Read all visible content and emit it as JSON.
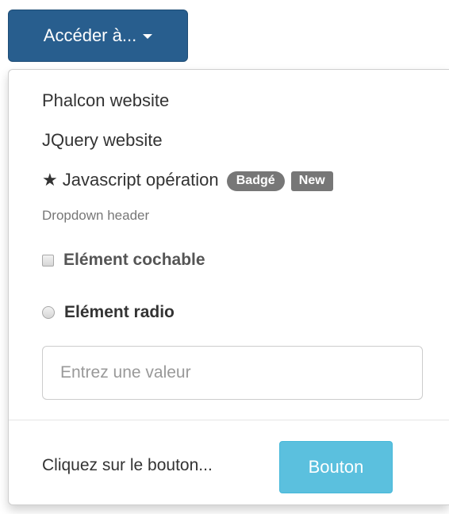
{
  "toggle": {
    "label": "Accéder à...",
    "color": "#285e8e"
  },
  "menu": {
    "items": [
      {
        "label": "Phalcon website"
      },
      {
        "label": "JQuery website"
      },
      {
        "label": "Javascript opération",
        "icon": "star-icon",
        "badge": "Badgé",
        "label_tag": "New"
      }
    ],
    "header": "Dropdown header",
    "checkbox": {
      "label": "Elément cochable",
      "checked": false
    },
    "radio": {
      "label": "Elément radio",
      "checked": false
    },
    "input": {
      "placeholder": "Entrez une valeur",
      "value": ""
    },
    "footer": {
      "text": "Cliquez sur le bouton...",
      "button_label": "Bouton",
      "button_color": "#5bc0de"
    }
  }
}
